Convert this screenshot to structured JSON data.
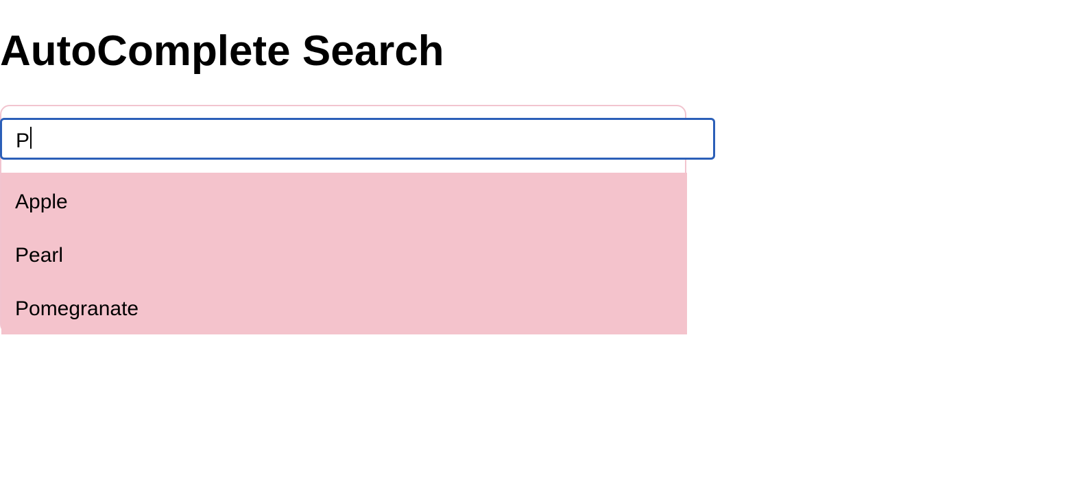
{
  "page": {
    "title": "AutoComplete Search"
  },
  "search": {
    "value": "P"
  },
  "suggestions": [
    "Apple",
    "Pearl",
    "Pomegranate"
  ],
  "colors": {
    "panel_border": "#f2c4cf",
    "focus_border": "#2b5fb8",
    "suggestions_background": "#f4c3cc"
  }
}
